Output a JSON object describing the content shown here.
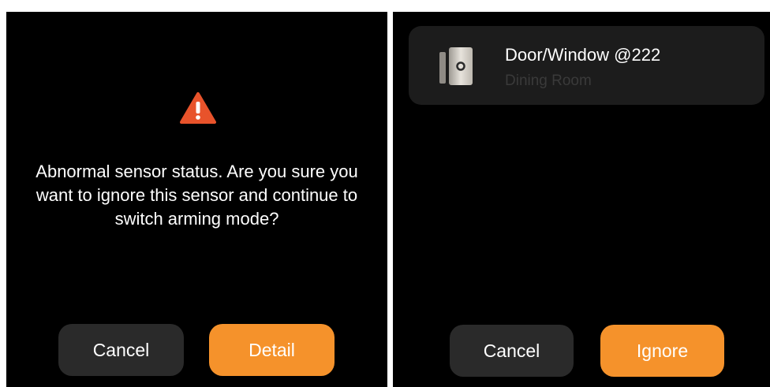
{
  "colors": {
    "panel_background": "#000000",
    "accent_orange": "#f5922b",
    "dark_button": "#2a2a2a",
    "card_background": "#1c1c1c",
    "warning_red": "#e8532b"
  },
  "icons": {
    "warning": "warning-triangle-icon",
    "sensor": "door-window-sensor-icon"
  },
  "confirm_dialog": {
    "message": "Abnormal sensor status. Are you sure you want to ignore this sensor and continue to switch arming mode?",
    "cancel_label": "Cancel",
    "detail_label": "Detail"
  },
  "detail_dialog": {
    "sensor": {
      "name": "Door/Window @222",
      "room": "Dining Room"
    },
    "cancel_label": "Cancel",
    "ignore_label": "Ignore"
  }
}
